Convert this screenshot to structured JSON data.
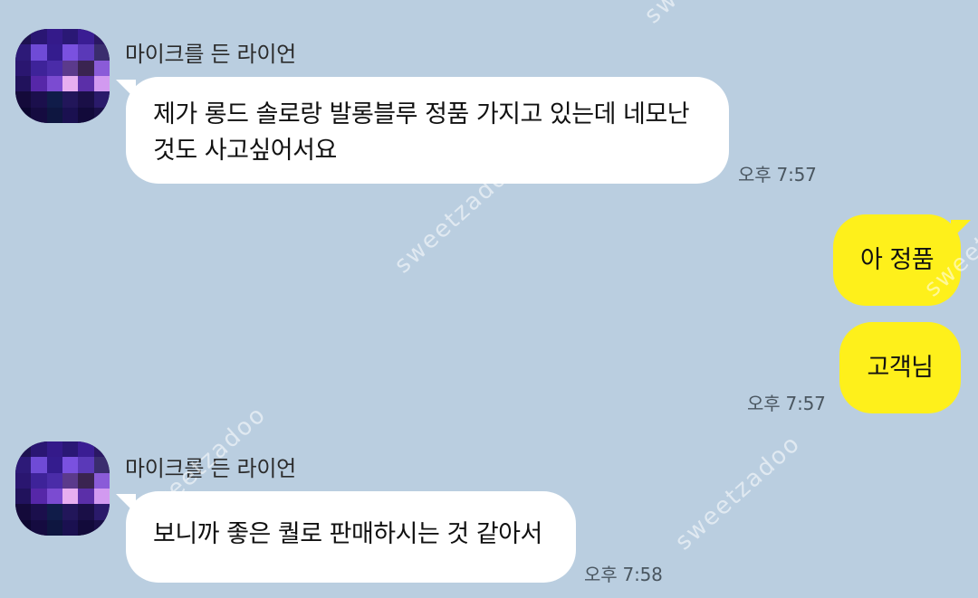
{
  "messages": [
    {
      "sender": "마이크를 든 라이언",
      "text": "제가 롱드 솔로랑 발롱블루 정품 가지고 있는데 네모난\n것도 사고싶어서요",
      "time": "오후 7:57"
    },
    {
      "text": "아 정품"
    },
    {
      "text": "고객님",
      "time": "오후 7:57"
    },
    {
      "sender": "마이크를 든 라이언",
      "text": "보니까 좋은 퀄로 판매하시는 것 같아서",
      "time": "오후 7:58"
    }
  ],
  "watermark": "sweetzadoo",
  "colors": {
    "background": "#bacee0",
    "incoming_bubble": "#ffffff",
    "outgoing_bubble": "#fef01b"
  },
  "avatar_pixels": [
    [
      "#1e1250",
      "#2a1673",
      "#341a8a",
      "#2a1875",
      "#3a1d93",
      "#2b1864"
    ],
    [
      "#2d1a78",
      "#6f4bd6",
      "#341c8e",
      "#7a51e0",
      "#5a39b8",
      "#3a2d6e"
    ],
    [
      "#2a1670",
      "#3e2399",
      "#4a2ca8",
      "#5b3a8c",
      "#3a2450",
      "#8a5bd8"
    ],
    [
      "#21125c",
      "#5627a8",
      "#7b4bd1",
      "#e7aef0",
      "#5b2fa8",
      "#d29af0"
    ],
    [
      "#140a3a",
      "#1b0f4c",
      "#101c49",
      "#22165a",
      "#1a0f47",
      "#2a1a6a"
    ],
    [
      "#0c0630",
      "#150b40",
      "#0e1640",
      "#1a1050",
      "#120a3a",
      "#1a1048"
    ]
  ]
}
